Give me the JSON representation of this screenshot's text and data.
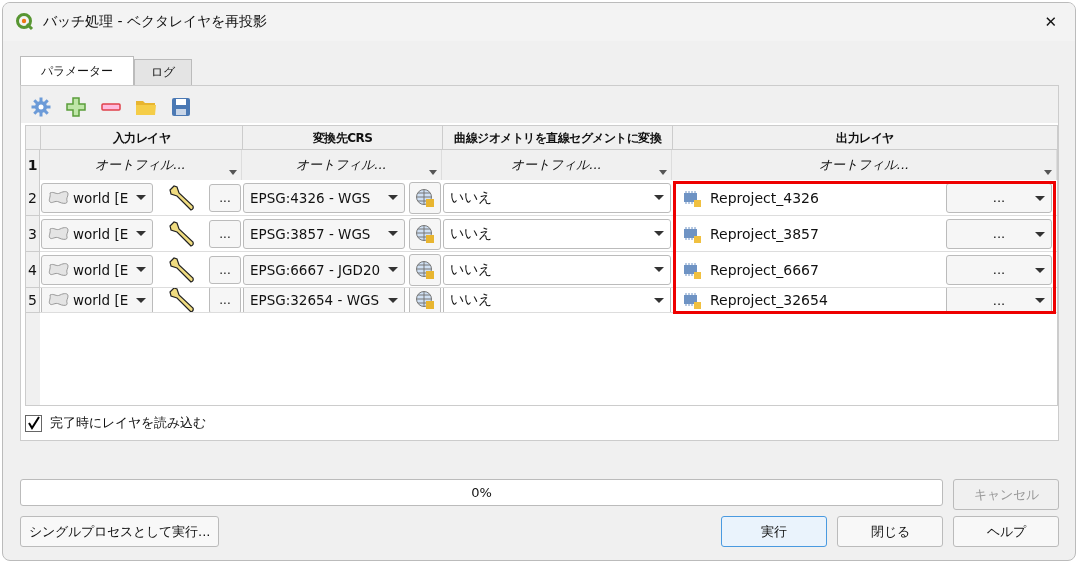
{
  "window": {
    "title": "バッチ処理 - ベクタレイヤを再投影",
    "close": "✕"
  },
  "tabs": [
    {
      "label": "パラメーター",
      "selected": true
    },
    {
      "label": "ログ",
      "selected": false
    }
  ],
  "table": {
    "columns": [
      "入力レイヤ",
      "変換先CRS",
      "曲線ジオメトリを直線セグメントに変換",
      "出力レイヤ"
    ],
    "filter_row": {
      "number": "1",
      "cells": [
        "オートフィル...",
        "オートフィル...",
        "オートフィル...",
        "オートフィル..."
      ]
    },
    "rows": [
      {
        "number": "2",
        "input_layer": "world [E",
        "input_button": "...",
        "crs": "EPSG:4326 - WGS",
        "curves": "いいえ",
        "output": "Reproject_4326",
        "output_button": "..."
      },
      {
        "number": "3",
        "input_layer": "world [E",
        "input_button": "...",
        "crs": "EPSG:3857 - WGS",
        "curves": "いいえ",
        "output": "Reproject_3857",
        "output_button": "..."
      },
      {
        "number": "4",
        "input_layer": "world [E",
        "input_button": "...",
        "crs": "EPSG:6667 - JGD20",
        "curves": "いいえ",
        "output": "Reproject_6667",
        "output_button": "..."
      },
      {
        "number": "5",
        "input_layer": "world [E",
        "input_button": "...",
        "crs": "EPSG:32654 - WGS",
        "curves": "いいえ",
        "output": "Reproject_32654",
        "output_button": "..."
      }
    ]
  },
  "load_layers": {
    "label": "完了時にレイヤを読み込む",
    "checked": true
  },
  "progress": {
    "text": "0%",
    "level": 0
  },
  "buttons": {
    "cancel": {
      "label": "キャンセル",
      "disabled": true
    },
    "single": {
      "label": "シングルプロセスとして実行..."
    },
    "run": {
      "label": "実行",
      "selected": true
    },
    "close": {
      "label": "閉じる"
    },
    "help": {
      "label": "ヘルプ"
    }
  }
}
